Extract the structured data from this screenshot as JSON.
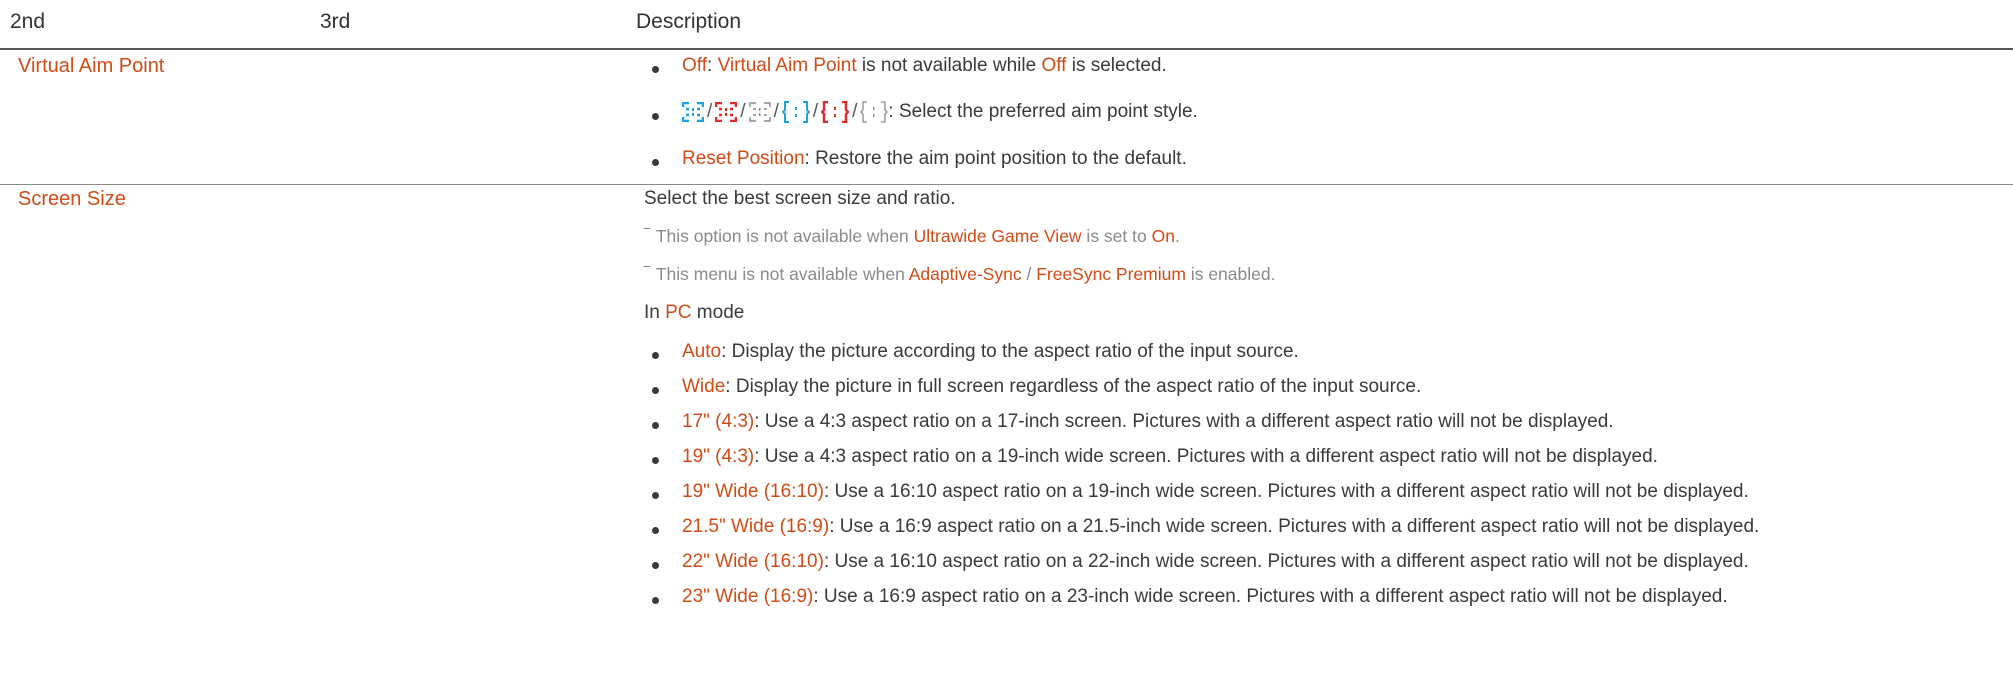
{
  "header": {
    "col2": "2nd",
    "col3": "3rd",
    "col_desc": "Description"
  },
  "colors": {
    "highlight": "#d14b16",
    "aim_blue": "#1fa0e0",
    "aim_red": "#e02a2a",
    "aim_gray": "#8a8a8a"
  },
  "virtual_aim_point": {
    "title": "Virtual Aim Point",
    "off_label": "Off",
    "off_sep": ": ",
    "off_name": "Virtual Aim Point",
    "off_text": " is not available while ",
    "off_label2": "Off",
    "off_tail": " is selected.",
    "icons": [
      "aim-style-1-blue-icon",
      "aim-style-1-red-icon",
      "aim-style-1-gray-icon",
      "aim-style-2-blue-icon",
      "aim-style-2-red-icon",
      "aim-style-2-gray-icon"
    ],
    "icons_tail": ": Select the preferred aim point style.",
    "reset_label": "Reset Position",
    "reset_text": ": Restore the aim point position to the default."
  },
  "screen_size": {
    "title": "Screen Size",
    "intro": "Select the best screen size and ratio.",
    "note1_pre": "This option is not available when ",
    "note1_hl1": "Ultrawide Game View",
    "note1_mid": " is set to ",
    "note1_hl2": "On",
    "note1_end": ".",
    "note2_pre": "This menu is not available when ",
    "note2_hl1": "Adaptive-Sync",
    "note2_mid": " / ",
    "note2_hl2": "FreeSync Premium",
    "note2_end": " is enabled.",
    "mode_pre": "In ",
    "mode_hl": "PC",
    "mode_post": " mode",
    "options": [
      {
        "label": "Auto",
        "text": ": Display the picture according to the aspect ratio of the input source."
      },
      {
        "label": "Wide",
        "text": ": Display the picture in full screen regardless of the aspect ratio of the input source."
      },
      {
        "label": "17\" (4:3)",
        "text": ": Use a 4:3 aspect ratio on a 17-inch screen. Pictures with a different aspect ratio will not be displayed."
      },
      {
        "label": "19\" (4:3)",
        "text": ": Use a 4:3 aspect ratio on a 19-inch wide screen. Pictures with a different aspect ratio will not be displayed."
      },
      {
        "label": "19\" Wide (16:10)",
        "text": ": Use a 16:10 aspect ratio on a 19-inch wide screen. Pictures with a different aspect ratio will not be displayed."
      },
      {
        "label": "21.5\" Wide (16:9)",
        "text": ": Use a 16:9 aspect ratio on a 21.5-inch wide screen. Pictures with a different aspect ratio will not be displayed."
      },
      {
        "label": "22\" Wide (16:10)",
        "text": ": Use a 16:10 aspect ratio on a 22-inch wide screen. Pictures with a different aspect ratio will not be displayed."
      },
      {
        "label": "23\" Wide (16:9)",
        "text": ": Use a 16:9 aspect ratio on a 23-inch wide screen. Pictures with a different aspect ratio will not be displayed."
      }
    ]
  }
}
